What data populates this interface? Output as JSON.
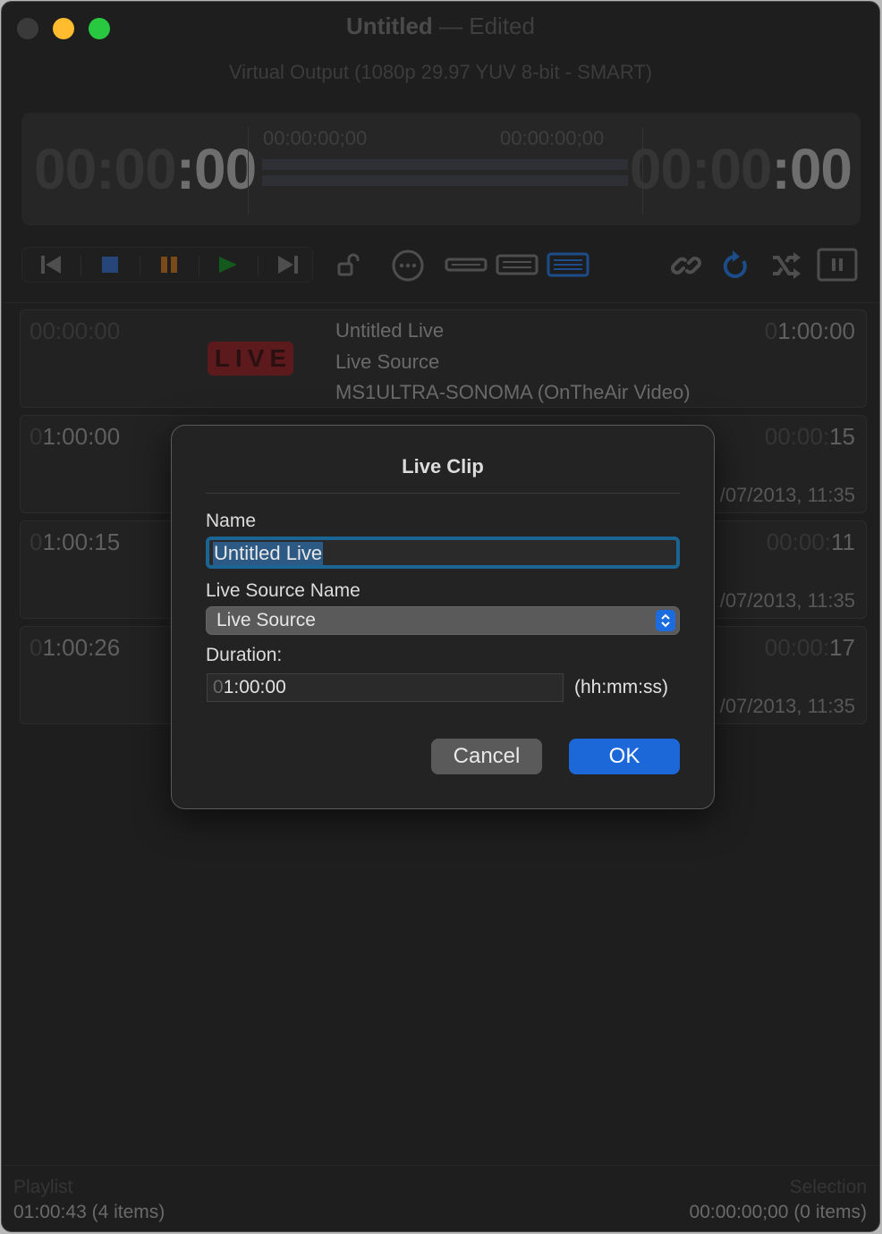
{
  "window": {
    "title": "Untitled",
    "title_sep": "—",
    "title_state": "Edited",
    "subtitle": "Virtual Output (1080p 29.97 YUV 8-bit - SMART)"
  },
  "timers": {
    "left": {
      "dim": "00:00",
      "lit": ":00"
    },
    "right": {
      "dim": "00:00",
      "lit": ":00"
    },
    "mid_left": "00:00:00;00",
    "mid_right": "00:00:00;00"
  },
  "toolbar": {
    "transport": [
      {
        "name": "previous-icon",
        "color": "#4e4e4e"
      },
      {
        "name": "stop-icon",
        "color": "#26467a"
      },
      {
        "name": "pause-icon",
        "color": "#7a4a18"
      },
      {
        "name": "play-icon",
        "color": "#155a1d"
      },
      {
        "name": "next-icon",
        "color": "#4e4e4e"
      }
    ],
    "accent_color": "#1c4d8a"
  },
  "playlist": [
    {
      "start_dim": "00:00:00",
      "start_lit": "",
      "badge": "LIVE",
      "name": "Untitled Live",
      "source": "Live Source",
      "host": "MS1ULTRA-SONOMA (OnTheAir Video)",
      "dur_dim": "0",
      "dur_lit": "1:00:00"
    },
    {
      "start_dim": "0",
      "start_lit": "1:00:00",
      "dur_dim": "00:00:",
      "dur_lit": "15",
      "date": "/07/2013, 11:35"
    },
    {
      "start_dim": "0",
      "start_lit": "1:00:15",
      "dur_dim": "00:00:",
      "dur_lit": "11",
      "date": "/07/2013, 11:35"
    },
    {
      "start_dim": "0",
      "start_lit": "1:00:26",
      "dur_dim": "00:00:",
      "dur_lit": "17",
      "date": "/07/2013, 11:35"
    }
  ],
  "footer": {
    "playlist_label": "Playlist",
    "playlist_value": "01:00:43 (4 items)",
    "selection_label": "Selection",
    "selection_value": "00:00:00;00 (0 items)"
  },
  "dialog": {
    "title": "Live Clip",
    "name_label": "Name",
    "name_value": "Untitled Live",
    "source_label": "Live Source Name",
    "source_value": "Live Source",
    "duration_label": "Duration:",
    "duration_dim": "0",
    "duration_value": "1:00:00",
    "duration_hint": "(hh:mm:ss)",
    "cancel_label": "Cancel",
    "ok_label": "OK"
  }
}
